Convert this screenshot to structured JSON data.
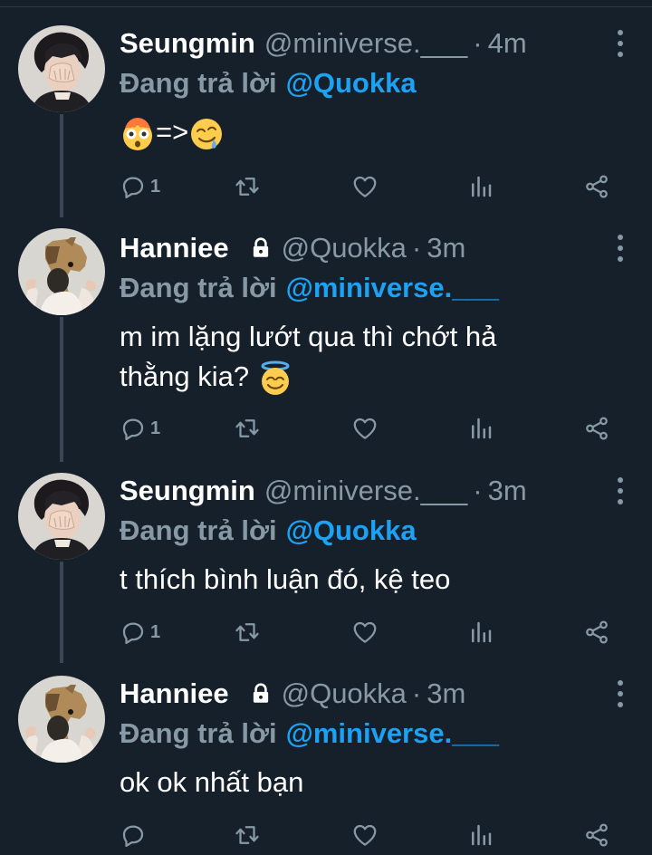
{
  "tweets": [
    {
      "name": "Seungmin",
      "handle": "@miniverse.___",
      "sep": "·",
      "time": "4m",
      "locked": false,
      "reply_label": "Đang trả lời",
      "reply_to": "@Quokka",
      "text": "",
      "emoji_text": "=>",
      "reply_count": "1",
      "avatar": "seungmin-avatar"
    },
    {
      "name": "Hanniee",
      "handle": "@Quokka",
      "sep": "·",
      "time": "3m",
      "locked": true,
      "reply_label": "Đang trả lời",
      "reply_to": "@miniverse.___",
      "text_line1": "m im lặng lướt qua thì chớt hả",
      "text_line2": "thằng kia?",
      "reply_count": "1",
      "avatar": "hanniee-avatar"
    },
    {
      "name": "Seungmin",
      "handle": "@miniverse.___",
      "sep": "·",
      "time": "3m",
      "locked": false,
      "reply_label": "Đang trả lời",
      "reply_to": "@Quokka",
      "text": "t thích bình luận đó, kệ teo",
      "reply_count": "1",
      "avatar": "seungmin-avatar"
    },
    {
      "name": "Hanniee",
      "handle": "@Quokka",
      "sep": "·",
      "time": "3m",
      "locked": true,
      "reply_label": "Đang trả lời",
      "reply_to": "@miniverse.___",
      "text": "ok ok nhất bạn",
      "reply_count": "",
      "avatar": "hanniee-avatar"
    }
  ],
  "icons": {
    "reply": "reply-icon",
    "retweet": "retweet-icon",
    "like": "heart-icon",
    "stats": "stats-icon",
    "share": "share-icon",
    "more": "more-vertical-icon",
    "lock": "lock-icon"
  },
  "colors": {
    "background": "#16202b",
    "muted": "#8899a6",
    "accent": "#1da1f2",
    "text": "#ffffff"
  }
}
